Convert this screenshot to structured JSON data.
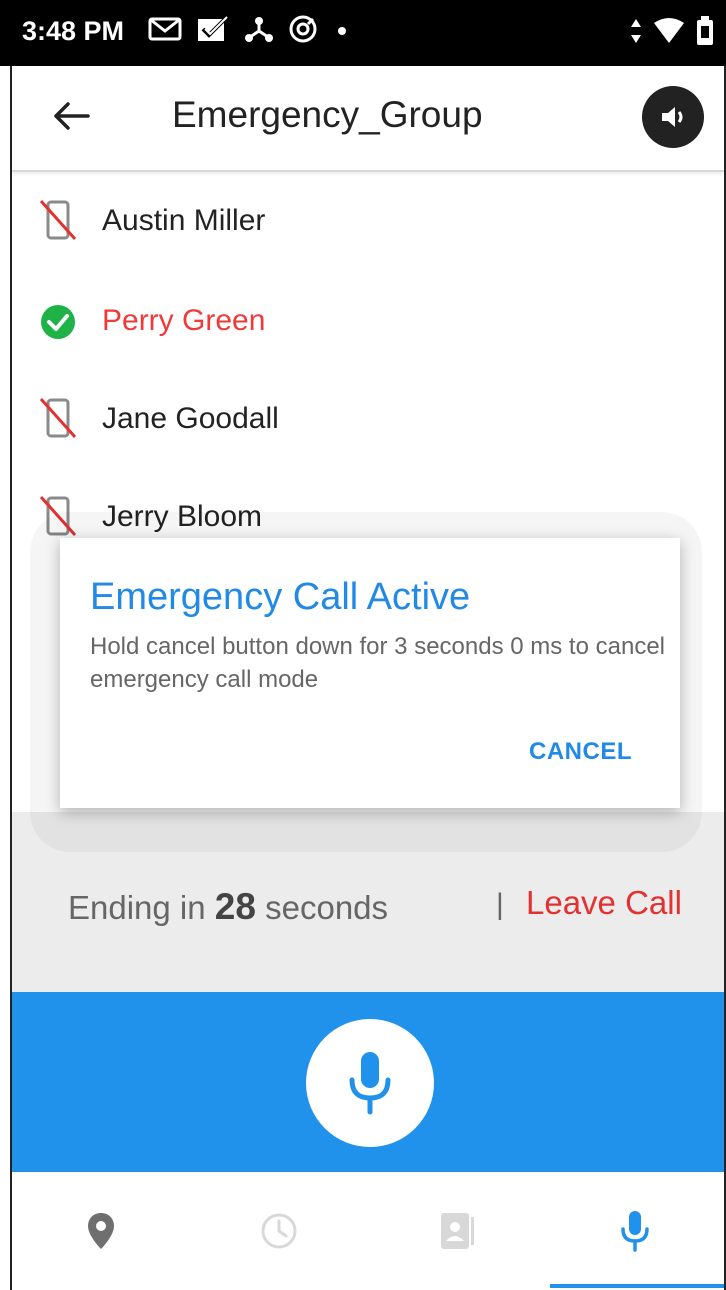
{
  "status_bar": {
    "time": "3:48 PM",
    "left_icons": [
      "gmail-icon",
      "checkbox-mail-icon",
      "network-icon",
      "location-icon",
      "dot-icon"
    ],
    "right_icons": [
      "data-arrows-icon",
      "wifi-icon",
      "battery-icon"
    ]
  },
  "header": {
    "title": "Emergency_Group",
    "back_icon": "arrow-left-icon",
    "speaker_icon": "speaker-icon"
  },
  "members": [
    {
      "name": "Austin Miller",
      "status": "unavailable",
      "icon": "phone-off-icon"
    },
    {
      "name": "Perry Green",
      "status": "active",
      "icon": "check-circle-icon"
    },
    {
      "name": "Jane Goodall",
      "status": "unavailable",
      "icon": "phone-off-icon"
    },
    {
      "name": "Jerry Bloom",
      "status": "unavailable",
      "icon": "phone-off-icon"
    }
  ],
  "dialog": {
    "title": "Emergency Call Active",
    "body": "Hold cancel button down for 3 seconds 0 ms to cancel emergency call mode",
    "cancel_label": "CANCEL"
  },
  "call_status": {
    "prefix": "Ending in",
    "seconds": "28",
    "suffix": "seconds",
    "separator": "|",
    "leave_label": "Leave Call"
  },
  "ptt": {
    "icon": "microphone-icon"
  },
  "bottom_nav": {
    "items": [
      {
        "icon": "location-pin-icon",
        "active": false
      },
      {
        "icon": "history-clock-icon",
        "active": false
      },
      {
        "icon": "contacts-icon",
        "active": false
      },
      {
        "icon": "microphone-icon",
        "active": true
      }
    ]
  },
  "colors": {
    "accent": "#2192ec",
    "dialog_accent": "#2189e6",
    "alert": "#e53030",
    "success": "#1fb347"
  }
}
